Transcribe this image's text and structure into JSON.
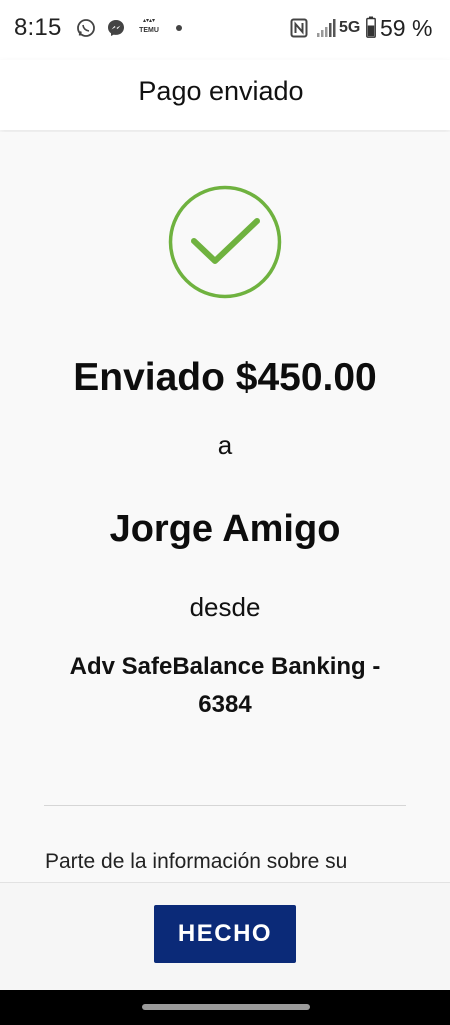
{
  "status_bar": {
    "time": "8:15",
    "temu_label": "TEMU",
    "network": "5G",
    "battery": "59 %",
    "icons": [
      "whatsapp-icon",
      "messenger-icon",
      "temu-icon",
      "notification-dot-icon",
      "nfc-icon",
      "signal-icon",
      "battery-icon"
    ]
  },
  "header": {
    "title": "Pago enviado"
  },
  "confirmation": {
    "icon": "check-circle-icon",
    "icon_color": "#6fb23f",
    "amount_line": "Enviado $450.00",
    "to_word": "a",
    "recipient": "Jorge Amigo",
    "from_word": "desde",
    "account": "Adv SafeBalance Banking - 6384",
    "info_text": "Parte de la información sobre su"
  },
  "footer": {
    "done_label": "HECHO",
    "button_color": "#0b2a78"
  }
}
